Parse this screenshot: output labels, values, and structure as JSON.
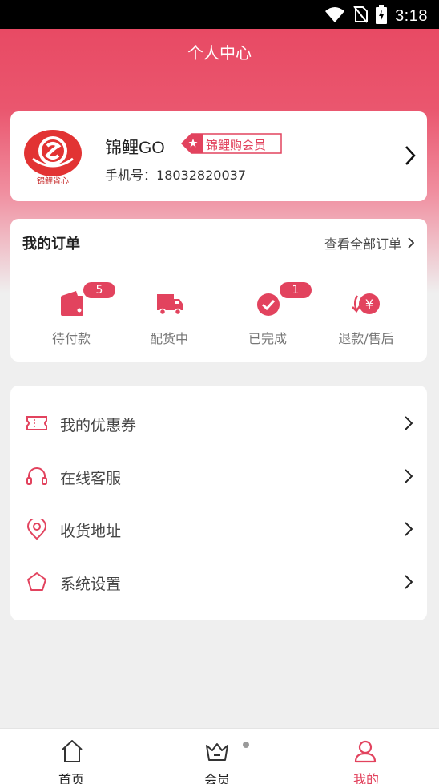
{
  "status_bar": {
    "time": "3:18",
    "icons": [
      "wifi-icon",
      "no-sim-icon",
      "battery-charging-icon"
    ]
  },
  "header": {
    "title": "个人中心"
  },
  "profile": {
    "logo_text": "锦鲤省心",
    "name": "锦鲤GO",
    "member_label": "锦鲤购会员",
    "phone_label": "手机号：",
    "phone_value": "18032820037"
  },
  "orders": {
    "title": "我的订单",
    "view_all": "查看全部订单",
    "items": [
      {
        "label": "待付款",
        "icon": "wallet-icon",
        "badge": "5"
      },
      {
        "label": "配货中",
        "icon": "truck-icon",
        "badge": ""
      },
      {
        "label": "已完成",
        "icon": "check-circle-icon",
        "badge": "1"
      },
      {
        "label": "退款/售后",
        "icon": "refund-icon",
        "badge": ""
      }
    ]
  },
  "menu": {
    "items": [
      {
        "label": "我的优惠券",
        "icon": "coupon-icon"
      },
      {
        "label": "在线客服",
        "icon": "headset-icon"
      },
      {
        "label": "收货地址",
        "icon": "location-pin-icon"
      },
      {
        "label": "系统设置",
        "icon": "pentagon-settings-icon"
      }
    ]
  },
  "tab_bar": {
    "tabs": [
      {
        "label": "首页",
        "icon": "home-icon",
        "active": false
      },
      {
        "label": "会员",
        "icon": "crown-icon",
        "active": false
      },
      {
        "label": "我的",
        "icon": "user-icon",
        "active": true
      }
    ]
  },
  "colors": {
    "accent": "#e2435e",
    "header": "#e84a64",
    "background": "#efefef"
  }
}
